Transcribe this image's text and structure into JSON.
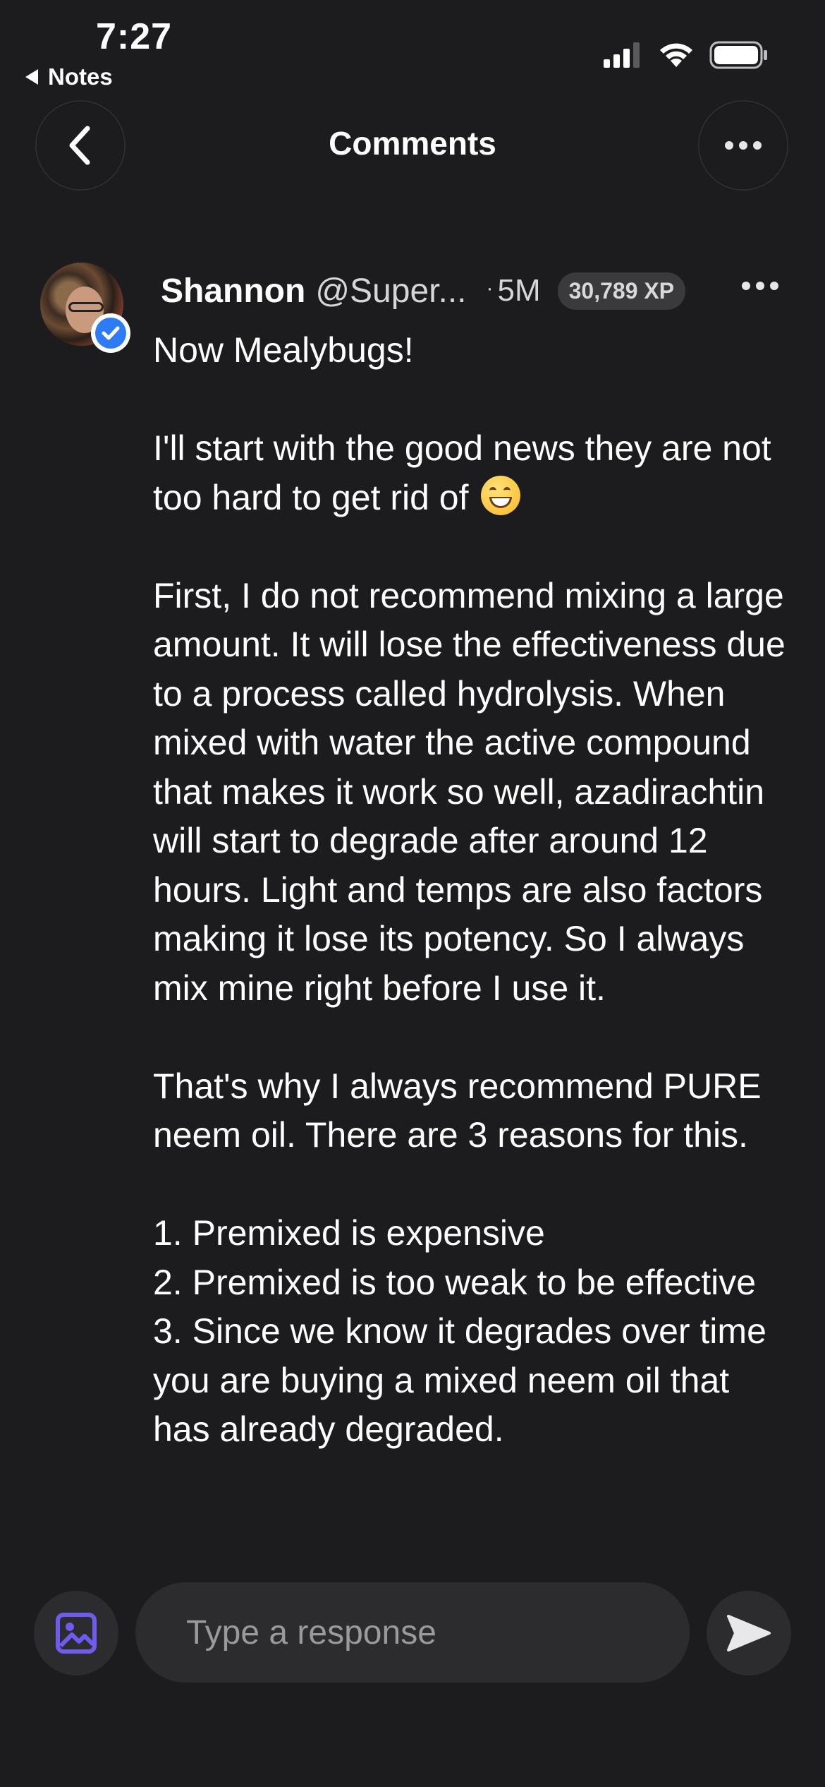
{
  "status_bar": {
    "time": "7:27",
    "back_app_label": "Notes",
    "icons": [
      "signal-icon",
      "wifi-icon",
      "battery-icon"
    ]
  },
  "header": {
    "title": "Comments",
    "icons": [
      "back-chevron-icon",
      "more-icon"
    ]
  },
  "comment": {
    "author_name": "Shannon",
    "author_handle": "@Super...",
    "time": "5M",
    "time_separator": "·",
    "xp": "30,789 XP",
    "verified": true,
    "paragraphs": [
      "Now Mealybugs!",
      "",
      "I'll start with the good news they are not too hard to get rid of",
      "",
      "First, I do not recommend mixing a large amount.  It will lose the effectiveness due to a process called hydrolysis.  When mixed with water the active compound that makes it work so well, azadirachtin will start to degrade after around 12 hours.  Light and temps are also factors making it lose its potency.  So I always mix mine right before I use it.",
      "",
      "That's why I always recommend PURE neem oil.  There are 3 reasons for this.",
      "",
      "1. Premixed is expensive",
      "2. Premixed is too weak to be effective",
      "3.  Since we know it degrades over time you are buying a mixed neem oil that has already degraded."
    ],
    "emoji": "grinning-face-with-smiling-eyes"
  },
  "composer": {
    "placeholder": "Type a response",
    "value": "",
    "accent_color": "#6e5cf0",
    "icons": [
      "image-icon",
      "send-icon"
    ]
  },
  "colors": {
    "background": "#1c1c1e",
    "surface": "#2c2c2e",
    "verified_blue": "#2d7cf6"
  }
}
